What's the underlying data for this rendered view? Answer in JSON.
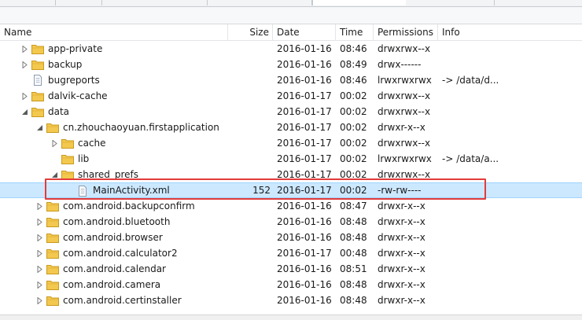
{
  "columns": [
    "Name",
    "Size",
    "Date",
    "Time",
    "Permissions",
    "Info"
  ],
  "rows": [
    {
      "name": "app-private",
      "depth": 1,
      "expand": "collapsed",
      "icon": "folder-icon",
      "size": "",
      "date": "2016-01-16",
      "time": "08:46",
      "perm": "drwxrwx--x",
      "info": ""
    },
    {
      "name": "backup",
      "depth": 1,
      "expand": "collapsed",
      "icon": "folder-icon",
      "size": "",
      "date": "2016-01-16",
      "time": "08:49",
      "perm": "drwx------",
      "info": ""
    },
    {
      "name": "bugreports",
      "depth": 1,
      "expand": "none",
      "icon": "file-icon",
      "size": "",
      "date": "2016-01-16",
      "time": "08:46",
      "perm": "lrwxrwxrwx",
      "info": "-> /data/d..."
    },
    {
      "name": "dalvik-cache",
      "depth": 1,
      "expand": "collapsed",
      "icon": "folder-icon",
      "size": "",
      "date": "2016-01-17",
      "time": "00:02",
      "perm": "drwxrwx--x",
      "info": ""
    },
    {
      "name": "data",
      "depth": 1,
      "expand": "expanded",
      "icon": "folder-icon",
      "size": "",
      "date": "2016-01-17",
      "time": "00:02",
      "perm": "drwxrwx--x",
      "info": ""
    },
    {
      "name": "cn.zhouchaoyuan.firstapplication",
      "depth": 2,
      "expand": "expanded",
      "icon": "folder-icon",
      "size": "",
      "date": "2016-01-17",
      "time": "00:02",
      "perm": "drwxr-x--x",
      "info": ""
    },
    {
      "name": "cache",
      "depth": 3,
      "expand": "collapsed",
      "icon": "folder-icon",
      "size": "",
      "date": "2016-01-17",
      "time": "00:02",
      "perm": "drwxrwx--x",
      "info": ""
    },
    {
      "name": "lib",
      "depth": 3,
      "expand": "none",
      "icon": "folder-icon",
      "size": "",
      "date": "2016-01-17",
      "time": "00:02",
      "perm": "lrwxrwxrwx",
      "info": "-> /data/a..."
    },
    {
      "name": "shared_prefs",
      "depth": 3,
      "expand": "expanded",
      "icon": "folder-icon",
      "size": "",
      "date": "2016-01-17",
      "time": "00:02",
      "perm": "drwxrwx--x",
      "info": ""
    },
    {
      "name": "MainActivity.xml",
      "depth": 4,
      "expand": "none",
      "icon": "file-icon",
      "size": "152",
      "date": "2016-01-17",
      "time": "00:02",
      "perm": "-rw-rw----",
      "info": "",
      "selected": true
    },
    {
      "name": "com.android.backupconfirm",
      "depth": 2,
      "expand": "collapsed",
      "icon": "folder-icon",
      "size": "",
      "date": "2016-01-16",
      "time": "08:47",
      "perm": "drwxr-x--x",
      "info": ""
    },
    {
      "name": "com.android.bluetooth",
      "depth": 2,
      "expand": "collapsed",
      "icon": "folder-icon",
      "size": "",
      "date": "2016-01-16",
      "time": "08:48",
      "perm": "drwxr-x--x",
      "info": ""
    },
    {
      "name": "com.android.browser",
      "depth": 2,
      "expand": "collapsed",
      "icon": "folder-icon",
      "size": "",
      "date": "2016-01-16",
      "time": "08:48",
      "perm": "drwxr-x--x",
      "info": ""
    },
    {
      "name": "com.android.calculator2",
      "depth": 2,
      "expand": "collapsed",
      "icon": "folder-icon",
      "size": "",
      "date": "2016-01-17",
      "time": "00:48",
      "perm": "drwxr-x--x",
      "info": ""
    },
    {
      "name": "com.android.calendar",
      "depth": 2,
      "expand": "collapsed",
      "icon": "folder-icon",
      "size": "",
      "date": "2016-01-16",
      "time": "08:51",
      "perm": "drwxr-x--x",
      "info": ""
    },
    {
      "name": "com.android.camera",
      "depth": 2,
      "expand": "collapsed",
      "icon": "folder-icon",
      "size": "",
      "date": "2016-01-16",
      "time": "08:48",
      "perm": "drwxr-x--x",
      "info": ""
    },
    {
      "name": "com.android.certinstaller",
      "depth": 2,
      "expand": "collapsed",
      "icon": "folder-icon",
      "size": "",
      "date": "2016-01-16",
      "time": "08:48",
      "perm": "drwxr-x--x",
      "info": ""
    }
  ],
  "colors": {
    "selection": "#cce8ff",
    "highlight_box": "#e33b3b",
    "folder": "#f3c84e"
  }
}
